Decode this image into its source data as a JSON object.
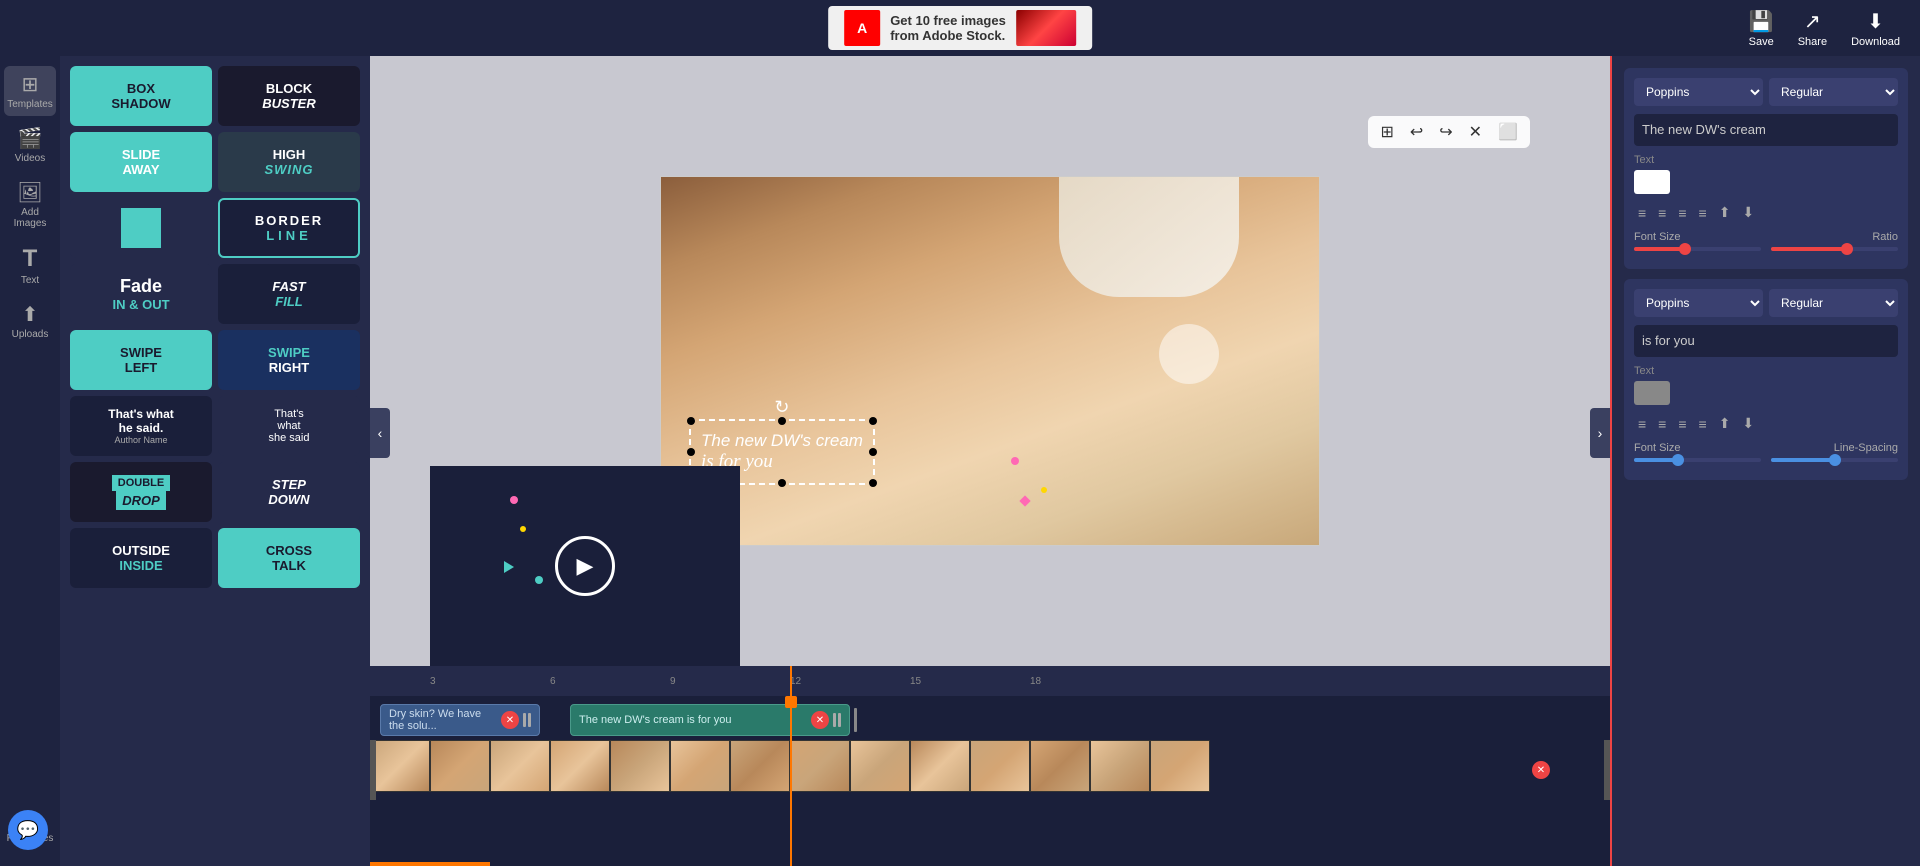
{
  "topBar": {
    "saveLabel": "Save",
    "shareLabel": "Share",
    "downloadLabel": "Download"
  },
  "adobe": {
    "logo": "A",
    "text": "Get 10 free images\nfrom Adobe Stock."
  },
  "sidebar": {
    "items": [
      {
        "id": "templates",
        "label": "Templates",
        "icon": "⊞"
      },
      {
        "id": "videos",
        "label": "Videos",
        "icon": "🎬"
      },
      {
        "id": "add-images",
        "label": "Add Images",
        "icon": "🖼"
      },
      {
        "id": "text",
        "label": "Text",
        "icon": "T"
      },
      {
        "id": "uploads",
        "label": "Uploads",
        "icon": "⬆"
      },
      {
        "id": "favourites",
        "label": "Favourites",
        "icon": "♥"
      }
    ]
  },
  "templates": [
    {
      "id": "box-shadow",
      "line1": "BOX",
      "line2": "SHADOW",
      "style": "tpl-1"
    },
    {
      "id": "block-buster",
      "line1": "BLOCK",
      "line2": "BUSTER",
      "style": "tpl-2"
    },
    {
      "id": "slide-away",
      "line1": "SLIDE",
      "line2": "AWAY",
      "style": "tpl-3"
    },
    {
      "id": "high-swing",
      "line1": "HIGH",
      "line2": "SWING",
      "style": "tpl-4"
    },
    {
      "id": "square",
      "line1": "",
      "line2": "",
      "style": "tpl-sq-wrap"
    },
    {
      "id": "border-line",
      "line1": "BORDER",
      "line2": "LINE",
      "style": "tpl-6"
    },
    {
      "id": "fade-in-out",
      "line1": "Fade",
      "sub": "IN & OUT",
      "style": "tpl-7"
    },
    {
      "id": "fast-fill",
      "line1": "FAST",
      "line2": "FILL",
      "style": "tpl-8"
    },
    {
      "id": "swipe-left",
      "line1": "SWIPE",
      "line2": "LEFT",
      "style": "tpl-9"
    },
    {
      "id": "swipe-right",
      "line1": "SWIPE",
      "line2": "RIGHT",
      "style": "tpl-10"
    },
    {
      "id": "thats-what-he-said",
      "line1": "That's what",
      "line2": "he said.",
      "style": "tpl-11"
    },
    {
      "id": "thats-what-she-said",
      "line1": "That's",
      "line2": "what",
      "line3": "she said",
      "style": "tpl-11"
    },
    {
      "id": "double-drop",
      "line1": "DOUBLE",
      "line2": "DROP",
      "style": "tpl-9"
    },
    {
      "id": "step-down",
      "line1": "STEP",
      "line2": "DOWN",
      "style": "tpl-5"
    },
    {
      "id": "outside-inside",
      "line1": "OUTSIDE",
      "line2": "INSIDE",
      "style": "tpl-1"
    },
    {
      "id": "cross-talk",
      "line1": "CROSS",
      "line2": "TALK",
      "style": "tpl-8"
    }
  ],
  "canvas": {
    "textLine1": "The new DW's cream",
    "textLine2": "is for you"
  },
  "rightPanel": {
    "section1": {
      "fontFamily": "Poppins",
      "fontStyle": "Regular",
      "textContent": "The new DW's cream",
      "textLabel": "Text",
      "fontSizeLabel": "Font Size",
      "ratioLabel": "Ratio",
      "fontSizeValue": 30,
      "ratioValue": 70
    },
    "section2": {
      "fontFamily": "Poppins",
      "fontStyle": "Regular",
      "textContent": "is for you",
      "textLabel": "Text",
      "fontSizeLabel": "Font Size",
      "lineSpacingLabel": "Line-Spacing",
      "fontSizeValue": 30,
      "lineSpacingValue": 50
    }
  },
  "timeline": {
    "clip1Label": "Dry skin? We have the solu...",
    "clip2Label": "The new DW's cream is for you",
    "playheadPosition": "49%",
    "rulerMarks": [
      "3",
      "6",
      "9",
      "12",
      "15",
      "18"
    ]
  }
}
